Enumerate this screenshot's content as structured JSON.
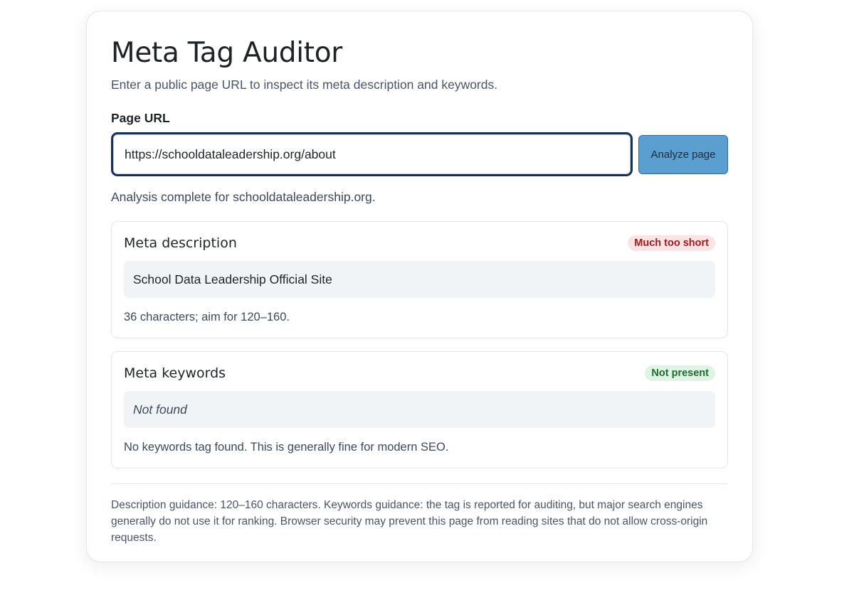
{
  "header": {
    "title": "Meta Tag Auditor",
    "subtitle": "Enter a public page URL to inspect its meta description and keywords."
  },
  "form": {
    "url_label": "Page URL",
    "url_value": "https://schooldataleadership.org/about",
    "analyze_label": "Analyze page"
  },
  "status": "Analysis complete for schooldataleadership.org.",
  "description_section": {
    "title": "Meta description",
    "badge": "Much too short",
    "badge_color": "#9b1c1c",
    "value": "School Data Leadership Official Site",
    "note": "36 characters; aim for 120–160."
  },
  "keywords_section": {
    "title": "Meta keywords",
    "badge": "Not present",
    "badge_color": "#1d6b33",
    "value": "Not found",
    "note": "No keywords tag found. This is generally fine for modern SEO."
  },
  "guidance": "Description guidance: 120–160 characters. Keywords guidance: the tag is reported for auditing, but major search engines generally do not use it for ranking. Browser security may prevent this page from reading sites that do not allow cross-origin requests.",
  "colors": {
    "accent_button": "#5b9fd1",
    "input_focus_border": "#17325a"
  }
}
